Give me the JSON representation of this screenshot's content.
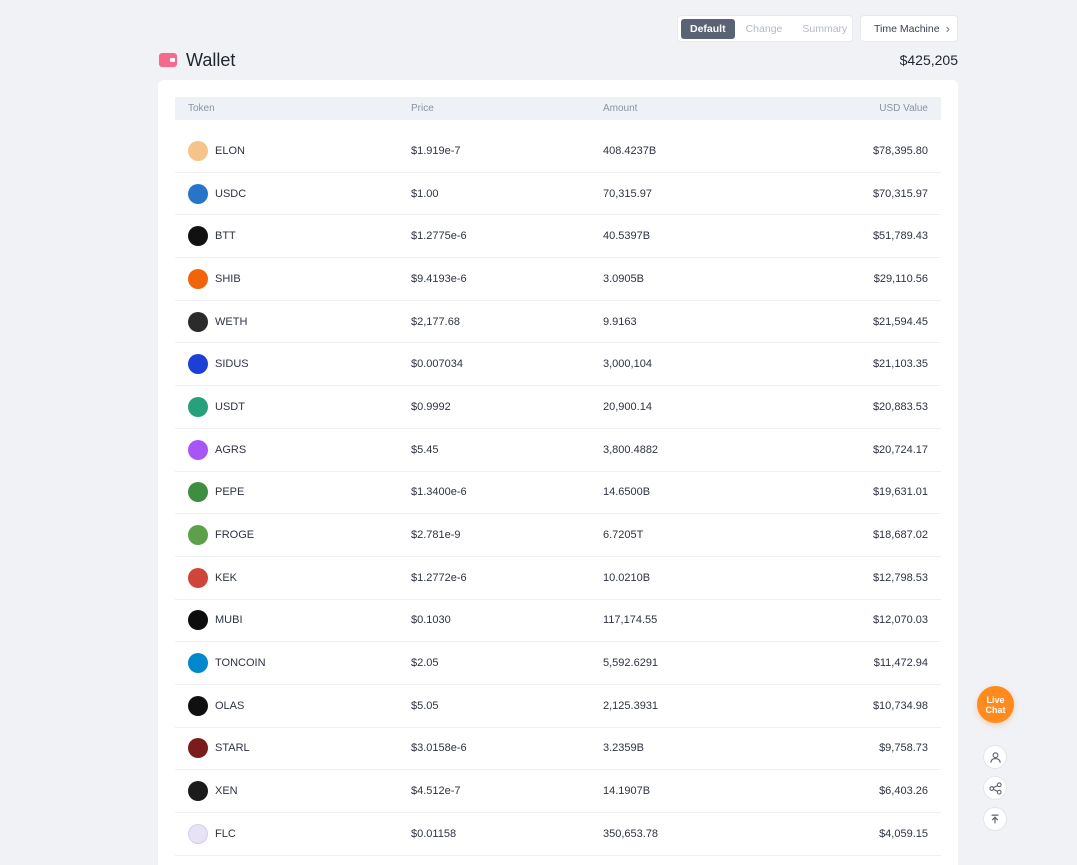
{
  "view_toggle": {
    "options": [
      "Default",
      "Change",
      "Summary"
    ],
    "active": "Default"
  },
  "time_machine": {
    "label": "Time Machine"
  },
  "wallet": {
    "title": "Wallet",
    "total_value": "$425,205"
  },
  "table": {
    "headers": {
      "token": "Token",
      "price": "Price",
      "amount": "Amount",
      "usd_value": "USD Value"
    },
    "rows": [
      {
        "symbol": "ELON",
        "price": "$1.919e-7",
        "amount": "408.4237B",
        "usd_value": "$78,395.80",
        "icon": "elon-dog-icon",
        "color": "#f5c48b"
      },
      {
        "symbol": "USDC",
        "price": "$1.00",
        "amount": "70,315.97",
        "usd_value": "$70,315.97",
        "icon": "usdc-icon",
        "color": "#2775ca"
      },
      {
        "symbol": "BTT",
        "price": "$1.2775e-6",
        "amount": "40.5397B",
        "usd_value": "$51,789.43",
        "icon": "btt-icon",
        "color": "#111111"
      },
      {
        "symbol": "SHIB",
        "price": "$9.4193e-6",
        "amount": "3.0905B",
        "usd_value": "$29,110.56",
        "icon": "shib-icon",
        "color": "#f0640a"
      },
      {
        "symbol": "WETH",
        "price": "$2,177.68",
        "amount": "9.9163",
        "usd_value": "$21,594.45",
        "icon": "weth-icon",
        "color": "#2b2b2b"
      },
      {
        "symbol": "SIDUS",
        "price": "$0.007034",
        "amount": "3,000,104",
        "usd_value": "$21,103.35",
        "icon": "sidus-icon",
        "color": "#1c3fd8"
      },
      {
        "symbol": "USDT",
        "price": "$0.9992",
        "amount": "20,900.14",
        "usd_value": "$20,883.53",
        "icon": "usdt-icon",
        "color": "#26a17b"
      },
      {
        "symbol": "AGRS",
        "price": "$5.45",
        "amount": "3,800.4882",
        "usd_value": "$20,724.17",
        "icon": "agrs-icon",
        "color": "#a855f7"
      },
      {
        "symbol": "PEPE",
        "price": "$1.3400e-6",
        "amount": "14.6500B",
        "usd_value": "$19,631.01",
        "icon": "pepe-icon",
        "color": "#3e8e41"
      },
      {
        "symbol": "FROGE",
        "price": "$2.781e-9",
        "amount": "6.7205T",
        "usd_value": "$18,687.02",
        "icon": "froge-icon",
        "color": "#5ca04a"
      },
      {
        "symbol": "KEK",
        "price": "$1.2772e-6",
        "amount": "10.0210B",
        "usd_value": "$12,798.53",
        "icon": "kek-icon",
        "color": "#d0453a"
      },
      {
        "symbol": "MUBI",
        "price": "$0.1030",
        "amount": "117,174.55",
        "usd_value": "$12,070.03",
        "icon": "mubi-icon",
        "color": "#0d0d0d"
      },
      {
        "symbol": "TONCOIN",
        "price": "$2.05",
        "amount": "5,592.6291",
        "usd_value": "$11,472.94",
        "icon": "toncoin-icon",
        "color": "#0088cc"
      },
      {
        "symbol": "OLAS",
        "price": "$5.05",
        "amount": "2,125.3931",
        "usd_value": "$10,734.98",
        "icon": "olas-icon",
        "color": "#101010"
      },
      {
        "symbol": "STARL",
        "price": "$3.0158e-6",
        "amount": "3.2359B",
        "usd_value": "$9,758.73",
        "icon": "starl-icon",
        "color": "#7a1c1c"
      },
      {
        "symbol": "XEN",
        "price": "$4.512e-7",
        "amount": "14.1907B",
        "usd_value": "$6,403.26",
        "icon": "xen-icon",
        "color": "#1b1b1b"
      },
      {
        "symbol": "FLC",
        "price": "$0.01158",
        "amount": "350,653.78",
        "usd_value": "$4,059.15",
        "icon": "flc-icon",
        "color": "#e8e2f5"
      }
    ]
  },
  "widgets": {
    "live_chat_label": "Live Chat"
  }
}
